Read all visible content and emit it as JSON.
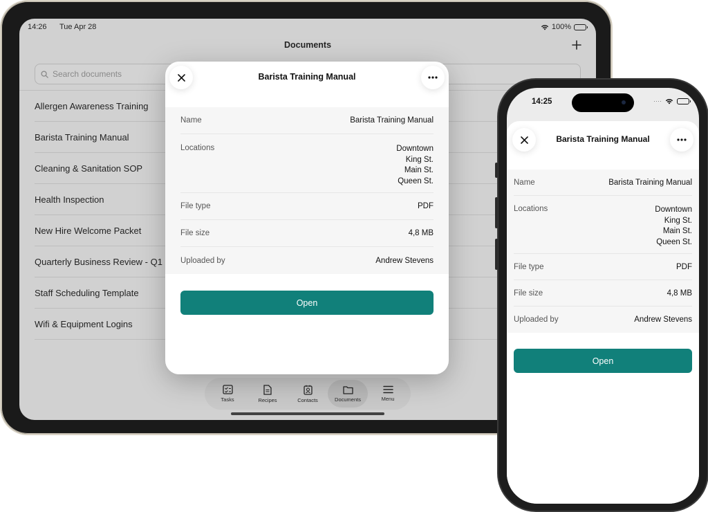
{
  "ipad": {
    "status": {
      "time": "14:26",
      "date": "Tue Apr 28",
      "battery": "100%"
    },
    "title": "Documents",
    "search": {
      "placeholder": "Search documents"
    },
    "documents": [
      "Allergen Awareness Training",
      "Barista Training Manual",
      "Cleaning & Sanitation SOP",
      "Health Inspection",
      "New Hire Welcome Packet",
      "Quarterly Business Review - Q1",
      "Staff Scheduling Template",
      "Wifi & Equipment Logins"
    ],
    "tabs": [
      {
        "label": "Tasks",
        "icon": "tasks-icon",
        "active": false
      },
      {
        "label": "Recipes",
        "icon": "document-icon",
        "active": false
      },
      {
        "label": "Contacts",
        "icon": "contacts-icon",
        "active": false
      },
      {
        "label": "Documents",
        "icon": "folder-icon",
        "active": true
      },
      {
        "label": "Menu",
        "icon": "menu-icon",
        "active": false
      }
    ]
  },
  "detail": {
    "title": "Barista Training Manual",
    "name_label": "Name",
    "name_value": "Barista Training Manual",
    "locations_label": "Locations",
    "locations": [
      "Downtown",
      "King St.",
      "Main St.",
      "Queen St."
    ],
    "filetype_label": "File type",
    "filetype_value": "PDF",
    "filesize_label": "File size",
    "filesize_value": "4,8 MB",
    "uploader_label": "Uploaded by",
    "uploader_value": "Andrew Stevens",
    "open_label": "Open"
  },
  "iphone": {
    "status": {
      "time": "14:25"
    }
  },
  "colors": {
    "accent": "#11807a"
  }
}
